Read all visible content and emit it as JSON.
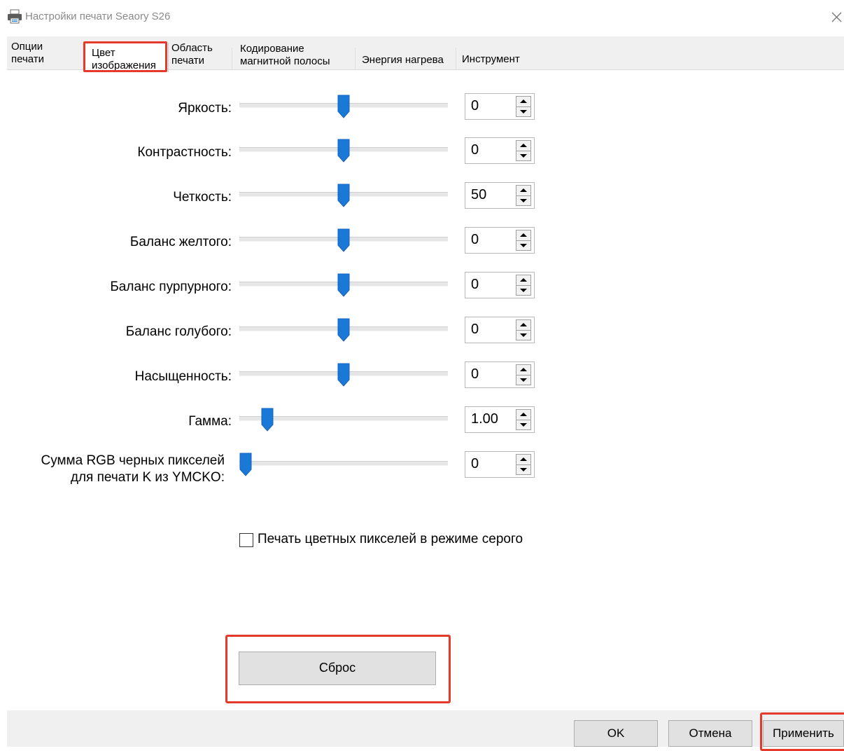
{
  "window": {
    "title": "Настройки печати Seaory S26",
    "icon": "printer-icon",
    "close_icon": "close-icon"
  },
  "tabs": [
    {
      "label": "Опции\nпечати"
    },
    {
      "label": "Цвет\nизображения",
      "active": true,
      "highlighted": true
    },
    {
      "label": "Область\nпечати"
    },
    {
      "label": "Кодирование\nмагнитной полосы"
    },
    {
      "label": "Энергия нагрева"
    },
    {
      "label": "Инструмент"
    }
  ],
  "sliders": [
    {
      "label": "Яркость:",
      "value": "0",
      "level": 0.5
    },
    {
      "label": "Контрастность:",
      "value": "0",
      "level": 0.5
    },
    {
      "label": "Четкость:",
      "value": "50",
      "level": 0.5
    },
    {
      "label": "Баланс желтого:",
      "value": "0",
      "level": 0.5
    },
    {
      "label": "Баланс пурпурного:",
      "value": "0",
      "level": 0.5
    },
    {
      "label": "Баланс голубого:",
      "value": "0",
      "level": 0.5
    },
    {
      "label": "Насыщенность:",
      "value": "0",
      "level": 0.5
    },
    {
      "label": "Гамма:",
      "value": "1.00",
      "level": 0.11
    },
    {
      "label": "Сумма RGB черных пикселей\nдля печати K из YMCKO:",
      "value": "0",
      "level": 0.0
    }
  ],
  "grayscale_checkbox": {
    "label": "Печать цветных пикселей в режиме серого",
    "checked": false
  },
  "reset_button": {
    "label": "Сброс",
    "highlighted": true
  },
  "footer": {
    "ok_label": "OK",
    "cancel_label": "Отмена",
    "apply_label": "Применить",
    "apply_highlighted": true
  },
  "colors": {
    "highlight": "#e53a2b",
    "thumb": "#1a78d6",
    "inactive_title": "#8a8a8a"
  }
}
